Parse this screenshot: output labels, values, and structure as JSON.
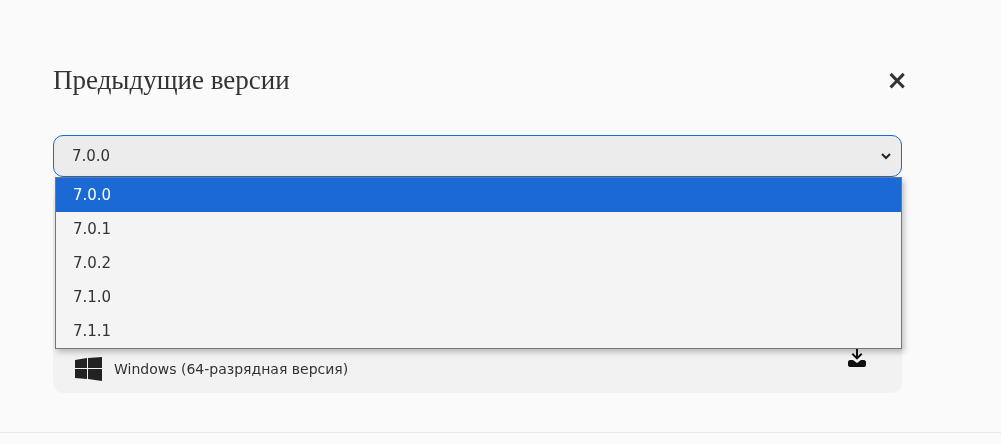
{
  "dialog": {
    "title": "Предыдущие версии",
    "close": "×"
  },
  "version_select": {
    "value": "7.0.0",
    "options": [
      {
        "label": "7.0.0",
        "selected": true
      },
      {
        "label": "7.0.1",
        "selected": false
      },
      {
        "label": "7.0.2",
        "selected": false
      },
      {
        "label": "7.1.0",
        "selected": false
      },
      {
        "label": "7.1.1",
        "selected": false
      }
    ]
  },
  "download": {
    "platform": "Windows (64-разрядная версия)"
  }
}
